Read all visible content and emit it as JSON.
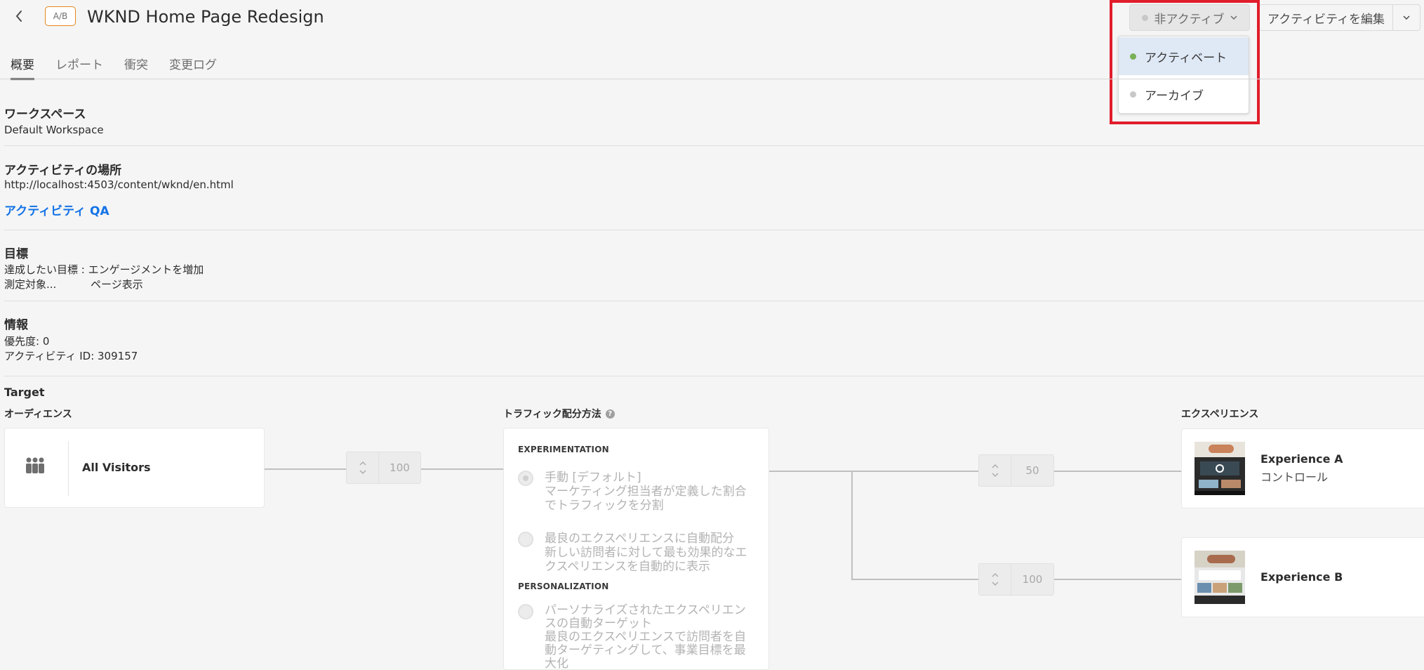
{
  "header": {
    "badge": "A/B",
    "title": "WKND Home Page Redesign",
    "status_label": "非アクティブ",
    "edit_label": "アクティビティを編集"
  },
  "status_menu": {
    "items": [
      {
        "label": "アクティベート",
        "dot_color": "#79b055"
      },
      {
        "label": "アーカイブ",
        "dot_color": "#c8c8c8"
      }
    ]
  },
  "tabs": [
    {
      "label": "概要",
      "active": true
    },
    {
      "label": "レポート",
      "active": false
    },
    {
      "label": "衝突",
      "active": false
    },
    {
      "label": "変更ログ",
      "active": false
    }
  ],
  "workspace": {
    "title": "ワークスペース",
    "value": "Default Workspace"
  },
  "location": {
    "title": "アクティビティの場所",
    "url": "http://localhost:4503/content/wknd/en.html",
    "qa_link": "アクティビティ QA"
  },
  "goal": {
    "title": "目標",
    "line1": "達成したい目標 : エンゲージメントを増加",
    "line2_label": "測定対象...",
    "line2_value": "ページ表示"
  },
  "info": {
    "title": "情報",
    "priority": "優先度: 0",
    "activity_id": "アクティビティ ID: 309157"
  },
  "target": {
    "title": "Target",
    "audience_title": "オーディエンス",
    "audience_name": "All Visitors",
    "audience_pct": "100",
    "traffic_title": "トラフィック配分方法",
    "experimentation_head": "EXPERIMENTATION",
    "opt_manual_title": "手動 [デフォルト]",
    "opt_manual_desc": "マーケティング担当者が定義した割合でトラフィックを分割",
    "opt_auto_title": "最良のエクスペリエンスに自動配分",
    "opt_auto_desc": "新しい訪問者に対して最も効果的なエクスペリエンスを自動的に表示",
    "personalization_head": "PERSONALIZATION",
    "opt_pers_title": "パーソナライズされたエクスペリエンスの自動ターゲット",
    "opt_pers_desc": "最良のエクスペリエンスで訪問者を自動ターゲティングして、事業目標を最大化",
    "experience_title": "エクスペリエンス",
    "exp_a_pct": "50",
    "exp_b_pct": "100",
    "exp_a_name": "Experience A",
    "exp_a_sub": "コントロール",
    "exp_b_name": "Experience B"
  },
  "colors": {
    "accent_link": "#1473e6",
    "badge_border": "#e68619",
    "highlight": "#e11d2b",
    "menu_selected_bg": "#dfe8f5"
  }
}
